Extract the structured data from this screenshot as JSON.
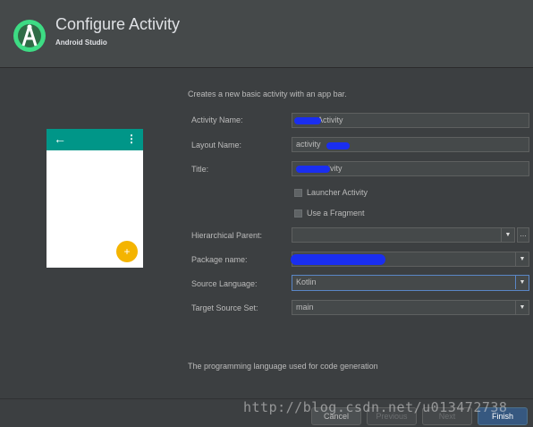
{
  "header": {
    "title": "Configure Activity",
    "subtitle": "Android Studio",
    "logo_icon": "android-studio-logo-icon"
  },
  "description": "Creates a new basic activity with an app bar.",
  "preview": {
    "back_icon": "←",
    "more_icon": "⋮",
    "fab_icon": "+",
    "toolbar_color": "#009688",
    "fab_color": "#f4b400"
  },
  "form": {
    "activity_name": {
      "label": "Activity Name:",
      "value": "Activity"
    },
    "layout_name": {
      "label": "Layout Name:",
      "value": "activity"
    },
    "title": {
      "label": "Title:",
      "value": "ivity"
    },
    "launcher_activity": {
      "label": "Launcher Activity",
      "checked": false
    },
    "use_fragment": {
      "label": "Use a Fragment",
      "checked": false
    },
    "hierarchical_parent": {
      "label": "Hierarchical Parent:",
      "value": "",
      "browse": "..."
    },
    "package_name": {
      "label": "Package name:",
      "value": ""
    },
    "source_language": {
      "label": "Source Language:",
      "value": "Kotlin"
    },
    "target_source_set": {
      "label": "Target Source Set:",
      "value": "main"
    }
  },
  "help_text": "The programming language used for code generation",
  "buttons": {
    "cancel": "Cancel",
    "previous": "Previous",
    "next": "Next",
    "finish": "Finish"
  },
  "watermark": "http://blog.csdn.net/u013472738",
  "colors": {
    "background": "#3c3f41",
    "accent": "#365880",
    "redaction": "#1a2ef0"
  }
}
